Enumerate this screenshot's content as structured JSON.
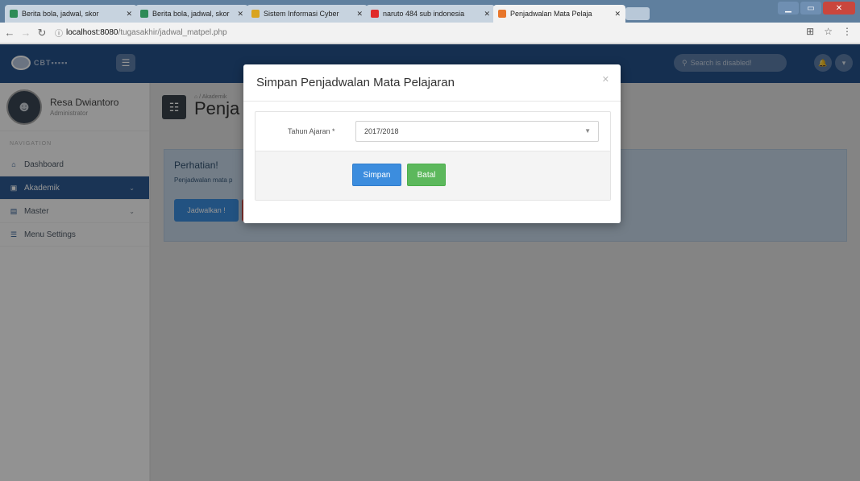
{
  "browser": {
    "tabs": [
      {
        "label": "Berita bola, jadwal, skor",
        "favicon_color": "#2e8b57",
        "active": false
      },
      {
        "label": "Berita bola, jadwal, skor",
        "favicon_color": "#2e8b57",
        "active": false
      },
      {
        "label": "Sistem Informasi Cyber",
        "favicon_color": "#d9a420",
        "active": false
      },
      {
        "label": "naruto 484 sub indonesia",
        "favicon_color": "#e02b2b",
        "active": false
      },
      {
        "label": "Penjadwalan Mata Pelaja",
        "favicon_color": "#e8762b",
        "active": true
      }
    ],
    "url_host": "localhost:8080",
    "url_path": "/tugasakhir/jadwal_matpel.php"
  },
  "topnav": {
    "search_placeholder": "Search is disabled!"
  },
  "sidebar": {
    "user_name": "Resa Dwiantoro",
    "user_role": "Administrator",
    "heading": "NAVIGATION",
    "items": [
      {
        "label": "Dashboard",
        "icon": "home-icon"
      },
      {
        "label": "Akademik",
        "icon": "book-icon",
        "active": true
      },
      {
        "label": "Master",
        "icon": "file-icon"
      },
      {
        "label": "Menu Settings",
        "icon": "list-icon"
      }
    ]
  },
  "page": {
    "breadcrumb": "Akademik",
    "title": "Penja",
    "alert_title": "Perhatian!",
    "alert_text": "Penjadwalan mata p",
    "alert_button": "Jadwalkan !"
  },
  "modal": {
    "title": "Simpan Penjadwalan Mata Pelajaran",
    "field_label": "Tahun Ajaran *",
    "field_value": "2017/2018",
    "save_label": "Simpan",
    "cancel_label": "Batal"
  },
  "colors": {
    "nav": "#25528a",
    "primary": "#3c8dde",
    "success": "#5cb85c",
    "danger": "#d9534f"
  }
}
